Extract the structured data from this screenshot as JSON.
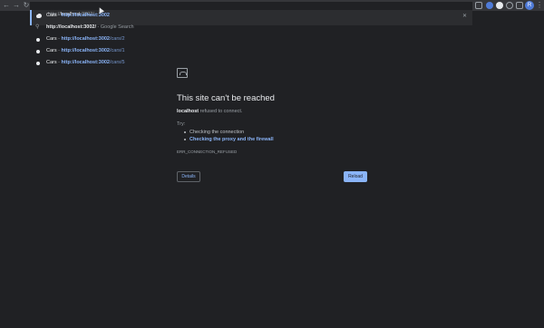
{
  "toolbar": {
    "back_glyph": "←",
    "forward_glyph": "→",
    "reload_glyph": "↻",
    "profile_initial": "R",
    "menu_glyph": "⋮",
    "extension_colors": [
      "#9aa0a6",
      "#4f7bd8",
      "#e8eaed",
      "#9aa0a6",
      "#9aa0a6"
    ]
  },
  "omnibox": {
    "input_prefix": "http://",
    "input_host": "localhost",
    "input_rest": ":3002/",
    "clear_glyph": "✕",
    "suggestions": [
      {
        "title": "Cars",
        "sep": " - ",
        "url_bold": "http://localhost:3002",
        "url_rest": ""
      },
      {
        "search_main": "http://localhost:3002/",
        "search_rest": " - Google Search"
      },
      {
        "title": "Cars",
        "sep": " - ",
        "url_bold": "http://localhost:3002",
        "url_rest": "/cars/2"
      },
      {
        "title": "Cars",
        "sep": " - ",
        "url_bold": "http://localhost:3002",
        "url_rest": "/cars/1"
      },
      {
        "title": "Cars",
        "sep": " - ",
        "url_bold": "http://localhost:3002",
        "url_rest": "/cars/5"
      }
    ]
  },
  "error": {
    "title": "This site can't be reached",
    "host": "localhost",
    "message": " refused to connect.",
    "try_label": "Try:",
    "suggestions": [
      "Checking the connection",
      "Checking the proxy and the firewall"
    ],
    "code": "ERR_CONNECTION_REFUSED",
    "details_label": "Details",
    "reload_label": "Reload"
  },
  "colors": {
    "background": "#202124",
    "toolbar": "#35363a",
    "accent": "#8ab4f8",
    "profile": "#4f7bd8"
  }
}
